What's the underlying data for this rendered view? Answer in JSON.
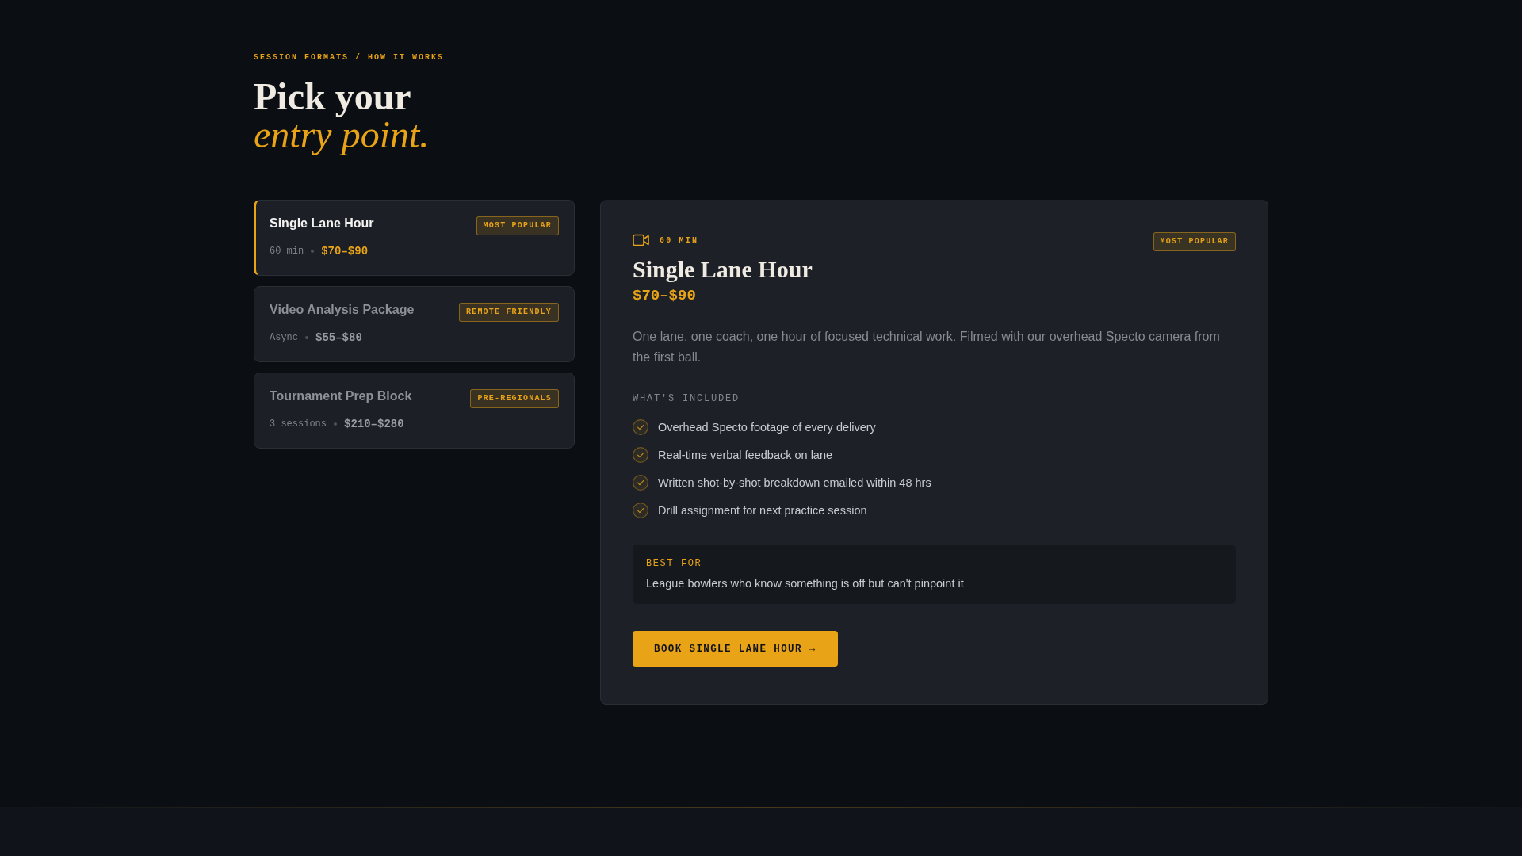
{
  "header": {
    "eyebrow": "SESSION FORMATS / HOW IT WORKS",
    "title": "Pick your",
    "title_accent": "entry point."
  },
  "formats": [
    {
      "title": "Single Lane Hour",
      "tag": "MOST POPULAR",
      "duration": "60 min",
      "price": "$70–$90",
      "selected": true
    },
    {
      "title": "Video Analysis Package",
      "tag": "REMOTE FRIENDLY",
      "duration": "Async",
      "price": "$55–$80",
      "selected": false
    },
    {
      "title": "Tournament Prep Block",
      "tag": "PRE-REGIONALS",
      "duration": "3 sessions",
      "price": "$210–$280",
      "selected": false
    }
  ],
  "detail": {
    "duration": "60 MIN",
    "tag": "MOST POPULAR",
    "title": "Single Lane Hour",
    "price": "$70–$90",
    "description": "One lane, one coach, one hour of focused technical work. Filmed with our overhead Specto camera from the first ball.",
    "included_heading": "WHAT'S INCLUDED",
    "included": [
      "Overhead Specto footage of every delivery",
      "Real-time verbal feedback on lane",
      "Written shot-by-shot breakdown emailed within 48 hrs",
      "Drill assignment for next practice session"
    ],
    "best_for_label": "BEST FOR",
    "best_for": "League bowlers who know something is off but can't pinpoint it",
    "button": "BOOK SINGLE LANE HOUR →"
  }
}
